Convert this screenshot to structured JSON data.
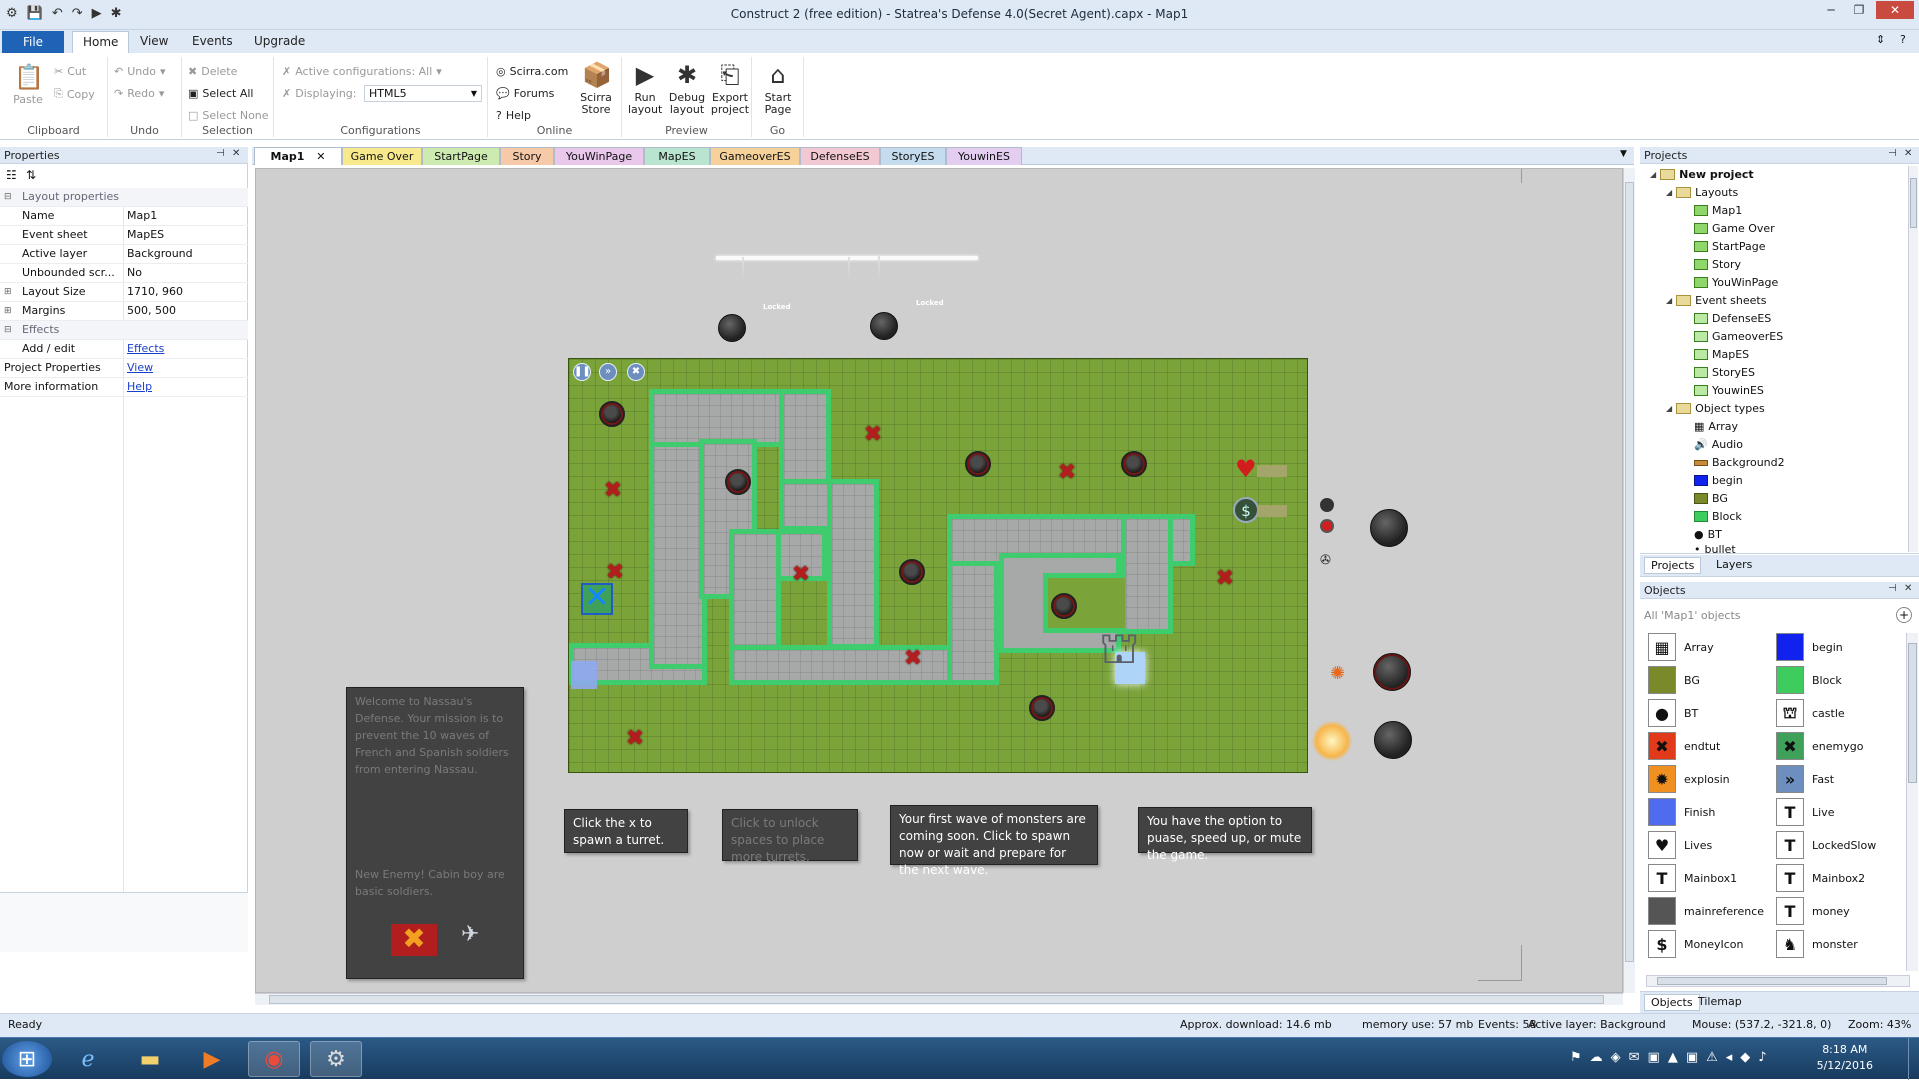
{
  "window": {
    "title": "Construct 2  (free edition) - Statrea's Defense 4.0(Secret Agent).capx - Map1",
    "minimize": "─",
    "restore": "❐",
    "close": "✕"
  },
  "menu": {
    "file": "File",
    "tabs": [
      "Home",
      "View",
      "Events",
      "Upgrade"
    ]
  },
  "ribbon": {
    "clipboard": {
      "label": "Clipboard",
      "paste": "Paste",
      "cut": "Cut",
      "copy": "Copy"
    },
    "undo": {
      "label": "Undo",
      "undo": "Undo",
      "redo": "Redo"
    },
    "selection": {
      "label": "Selection",
      "delete": "Delete",
      "select_all": "Select All",
      "select_none": "Select None"
    },
    "configurations": {
      "label": "Configurations",
      "active": "Active configurations: All",
      "displaying_label": "Displaying:",
      "displaying_value": "HTML5"
    },
    "online": {
      "label": "Online",
      "scirra": "Scirra.com",
      "forums": "Forums",
      "help": "Help",
      "store": "Scirra Store"
    },
    "preview": {
      "label": "Preview",
      "run": "Run layout",
      "debug": "Debug layout",
      "export": "Export project"
    },
    "go": {
      "label": "Go",
      "start": "Start Page"
    }
  },
  "properties": {
    "title": "Properties",
    "section_layout": "Layout properties",
    "rows": [
      {
        "k": "Name",
        "v": "Map1"
      },
      {
        "k": "Event sheet",
        "v": "MapES"
      },
      {
        "k": "Active layer",
        "v": "Background"
      },
      {
        "k": "Unbounded scr...",
        "v": "No"
      },
      {
        "k": "Layout Size",
        "v": "1710, 960"
      },
      {
        "k": "Margins",
        "v": "500, 500"
      }
    ],
    "section_effects": "Effects",
    "add_edit": "Add / edit",
    "effects_link": "Effects",
    "project_props": "Project Properties",
    "view_link": "View",
    "more_info": "More information",
    "help_link": "Help"
  },
  "doc_tabs": [
    {
      "label": "Map1",
      "color": "#ffffff"
    },
    {
      "label": "Game Over",
      "color": "#f8ea8c"
    },
    {
      "label": "StartPage",
      "color": "#cdeab0"
    },
    {
      "label": "Story",
      "color": "#f6c9a8"
    },
    {
      "label": "YouWinPage",
      "color": "#e9c8ec"
    },
    {
      "label": "MapES",
      "color": "#b9e4cf"
    },
    {
      "label": "GameoverES",
      "color": "#f6d29a"
    },
    {
      "label": "DefenseES",
      "color": "#f2c9d2"
    },
    {
      "label": "StoryES",
      "color": "#c5dcef"
    },
    {
      "label": "YouwinES",
      "color": "#e3cdf0"
    }
  ],
  "canvas": {
    "locked1": "Locked",
    "locked2": "Locked",
    "welcome": "Welcome to Nassau's Defense. Your mission is to prevent the 10 waves of French and Spanish soldiers from entering Nassau.",
    "new_enemy": "New Enemy! Cabin boy are basic soldiers.",
    "tip_turret": "Click the x to spawn a turret.",
    "tip_unlock": "Click to unlock spaces to place more turrets.",
    "tip_wave": "Your first wave of monsters are coming soon. Click to spawn now or wait and prepare for the next wave.",
    "tip_options": "You have the option to puase, speed up, or mute the game."
  },
  "projects": {
    "title": "Projects",
    "root": "New project",
    "layouts_folder": "Layouts",
    "layouts": [
      "Map1",
      "Game Over",
      "StartPage",
      "Story",
      "YouWinPage"
    ],
    "events_folder": "Event sheets",
    "event_sheets": [
      "DefenseES",
      "GameoverES",
      "MapES",
      "StoryES",
      "YouwinES"
    ],
    "objects_folder": "Object types",
    "object_types": [
      "Array",
      "Audio",
      "Background2",
      "begin",
      "BG",
      "Block",
      "BT",
      "bullet"
    ],
    "tab_projects": "Projects",
    "tab_layers": "Layers"
  },
  "objects": {
    "title": "Objects",
    "filter": "All 'Map1' objects",
    "items": [
      {
        "name": "Array",
        "color": "#ffffff",
        "glyph": "▦"
      },
      {
        "name": "begin",
        "color": "#1122ee",
        "glyph": ""
      },
      {
        "name": "BG",
        "color": "#7a8a2a",
        "glyph": ""
      },
      {
        "name": "Block",
        "color": "#3ecc5e",
        "glyph": ""
      },
      {
        "name": "BT",
        "color": "#ffffff",
        "glyph": "●"
      },
      {
        "name": "castle",
        "color": "#ffffff",
        "glyph": "⛫"
      },
      {
        "name": "endtut",
        "color": "#e03a1a",
        "glyph": "✖"
      },
      {
        "name": "enemygo",
        "color": "#3fa05a",
        "glyph": "✖"
      },
      {
        "name": "explosin",
        "color": "#f09020",
        "glyph": "✹"
      },
      {
        "name": "Fast",
        "color": "#6d8fbf",
        "glyph": "»"
      },
      {
        "name": "Finish",
        "color": "#4f6cf0",
        "glyph": ""
      },
      {
        "name": "Live",
        "color": "#ffffff",
        "glyph": "T"
      },
      {
        "name": "Lives",
        "color": "#ffffff",
        "glyph": "♥"
      },
      {
        "name": "LockedSlow",
        "color": "#ffffff",
        "glyph": "T"
      },
      {
        "name": "Mainbox1",
        "color": "#ffffff",
        "glyph": "T"
      },
      {
        "name": "Mainbox2",
        "color": "#ffffff",
        "glyph": "T"
      },
      {
        "name": "mainreference",
        "color": "#555555",
        "glyph": ""
      },
      {
        "name": "money",
        "color": "#ffffff",
        "glyph": "T"
      },
      {
        "name": "MoneyIcon",
        "color": "#ffffff",
        "glyph": "$"
      },
      {
        "name": "monster",
        "color": "#ffffff",
        "glyph": "♞"
      }
    ],
    "tab_objects": "Objects",
    "tab_tilemap": "Tilemap"
  },
  "status": {
    "ready": "Ready",
    "download": "Approx. download: 14.6 mb",
    "memory": "memory use: 57 mb",
    "events": "Events: 58",
    "active_layer": "Active layer: Background",
    "mouse": "Mouse: (537.2, -321.8, 0)",
    "zoom": "Zoom: 43%"
  },
  "clock": {
    "time": "8:18 AM",
    "date": "5/12/2016"
  }
}
